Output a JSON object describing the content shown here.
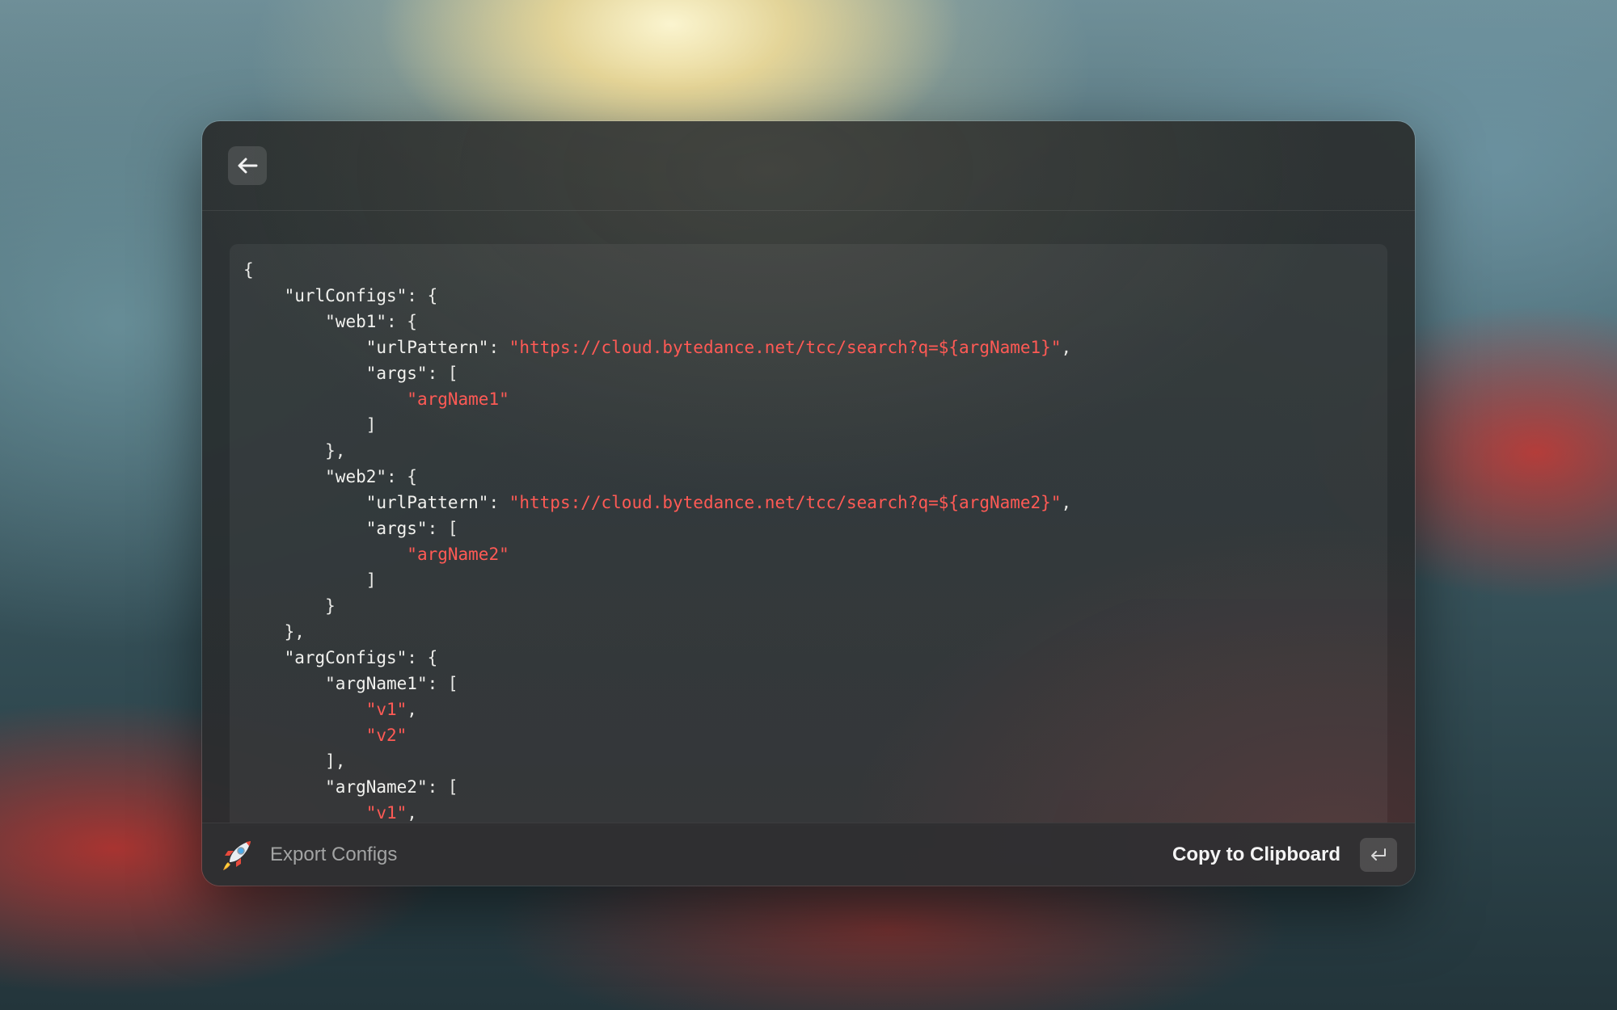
{
  "header": {
    "back_icon": "arrow-left-icon"
  },
  "code": {
    "lines": [
      {
        "indent": 0,
        "parts": [
          {
            "t": "p",
            "v": "{"
          }
        ]
      },
      {
        "indent": 1,
        "parts": [
          {
            "t": "k",
            "v": "\"urlConfigs\""
          },
          {
            "t": "p",
            "v": ": {"
          }
        ]
      },
      {
        "indent": 2,
        "parts": [
          {
            "t": "k",
            "v": "\"web1\""
          },
          {
            "t": "p",
            "v": ": {"
          }
        ]
      },
      {
        "indent": 3,
        "parts": [
          {
            "t": "k",
            "v": "\"urlPattern\""
          },
          {
            "t": "p",
            "v": ": "
          },
          {
            "t": "s",
            "v": "\"https://cloud.bytedance.net/tcc/search?q=${argName1}\""
          },
          {
            "t": "p",
            "v": ","
          }
        ]
      },
      {
        "indent": 3,
        "parts": [
          {
            "t": "k",
            "v": "\"args\""
          },
          {
            "t": "p",
            "v": ": ["
          }
        ]
      },
      {
        "indent": 4,
        "parts": [
          {
            "t": "s",
            "v": "\"argName1\""
          }
        ]
      },
      {
        "indent": 3,
        "parts": [
          {
            "t": "p",
            "v": "]"
          }
        ]
      },
      {
        "indent": 2,
        "parts": [
          {
            "t": "p",
            "v": "},"
          }
        ]
      },
      {
        "indent": 2,
        "parts": [
          {
            "t": "k",
            "v": "\"web2\""
          },
          {
            "t": "p",
            "v": ": {"
          }
        ]
      },
      {
        "indent": 3,
        "parts": [
          {
            "t": "k",
            "v": "\"urlPattern\""
          },
          {
            "t": "p",
            "v": ": "
          },
          {
            "t": "s",
            "v": "\"https://cloud.bytedance.net/tcc/search?q=${argName2}\""
          },
          {
            "t": "p",
            "v": ","
          }
        ]
      },
      {
        "indent": 3,
        "parts": [
          {
            "t": "k",
            "v": "\"args\""
          },
          {
            "t": "p",
            "v": ": ["
          }
        ]
      },
      {
        "indent": 4,
        "parts": [
          {
            "t": "s",
            "v": "\"argName2\""
          }
        ]
      },
      {
        "indent": 3,
        "parts": [
          {
            "t": "p",
            "v": "]"
          }
        ]
      },
      {
        "indent": 2,
        "parts": [
          {
            "t": "p",
            "v": "}"
          }
        ]
      },
      {
        "indent": 1,
        "parts": [
          {
            "t": "p",
            "v": "},"
          }
        ]
      },
      {
        "indent": 1,
        "parts": [
          {
            "t": "k",
            "v": "\"argConfigs\""
          },
          {
            "t": "p",
            "v": ": {"
          }
        ]
      },
      {
        "indent": 2,
        "parts": [
          {
            "t": "k",
            "v": "\"argName1\""
          },
          {
            "t": "p",
            "v": ": ["
          }
        ]
      },
      {
        "indent": 3,
        "parts": [
          {
            "t": "s",
            "v": "\"v1\""
          },
          {
            "t": "p",
            "v": ","
          }
        ]
      },
      {
        "indent": 3,
        "parts": [
          {
            "t": "s",
            "v": "\"v2\""
          }
        ]
      },
      {
        "indent": 2,
        "parts": [
          {
            "t": "p",
            "v": "],"
          }
        ]
      },
      {
        "indent": 2,
        "parts": [
          {
            "t": "k",
            "v": "\"argName2\""
          },
          {
            "t": "p",
            "v": ": ["
          }
        ]
      },
      {
        "indent": 3,
        "parts": [
          {
            "t": "s",
            "v": "\"v1\""
          },
          {
            "t": "p",
            "v": ","
          }
        ]
      }
    ]
  },
  "footer": {
    "icon": "rocket-icon",
    "title": "Export Configs",
    "action_label": "Copy to Clipboard",
    "action_key_icon": "return-key-icon"
  },
  "colors": {
    "string": "#ff5a55",
    "text": "#e9e9e6",
    "footer_title": "#a3a4a4"
  }
}
